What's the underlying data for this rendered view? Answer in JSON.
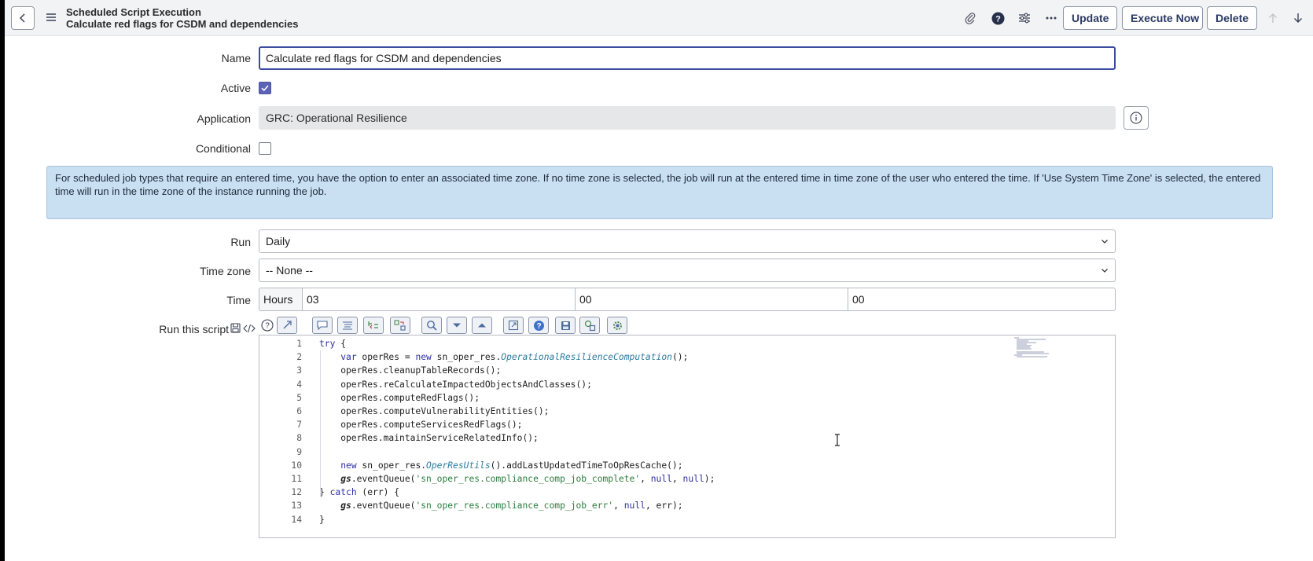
{
  "header": {
    "record_type": "Scheduled Script Execution",
    "record_name": "Calculate red flags for CSDM and dependencies",
    "buttons": {
      "update": "Update",
      "execute_now": "Execute Now",
      "delete": "Delete"
    },
    "icons": [
      "back-icon",
      "menu-icon",
      "paperclip-icon",
      "help-icon",
      "settings-sliders-icon",
      "more-icon",
      "arrow-up-icon",
      "arrow-down-icon"
    ]
  },
  "form": {
    "name": {
      "label": "Name",
      "value": "Calculate red flags for CSDM and dependencies"
    },
    "active": {
      "label": "Active",
      "checked": true
    },
    "application": {
      "label": "Application",
      "value": "GRC: Operational Resilience"
    },
    "conditional": {
      "label": "Conditional",
      "checked": false
    },
    "notice": "For scheduled job types that require an entered time, you have the option to enter an associated time zone. If no time zone is selected, the job will run at the entered time in time zone of the user who entered the time. If 'Use System Time Zone' is selected, the entered time will run in the time zone of the instance running the job.",
    "run": {
      "label": "Run",
      "value": "Daily"
    },
    "time_zone": {
      "label": "Time zone",
      "value": "-- None --"
    },
    "time": {
      "label": "Time",
      "unit": "Hours",
      "hours": "03",
      "minutes": "00",
      "seconds": "00"
    },
    "script": {
      "label": "Run this script"
    }
  },
  "script_lines": [
    {
      "n": "1",
      "text": "try {"
    },
    {
      "n": "2",
      "text": "    var operRes = new sn_oper_res.OperationalResilienceComputation();"
    },
    {
      "n": "3",
      "text": "    operRes.cleanupTableRecords();"
    },
    {
      "n": "4",
      "text": "    operRes.reCalculateImpactedObjectsAndClasses();"
    },
    {
      "n": "5",
      "text": "    operRes.computeRedFlags();"
    },
    {
      "n": "6",
      "text": "    operRes.computeVulnerabilityEntities();"
    },
    {
      "n": "7",
      "text": "    operRes.computeServicesRedFlags();"
    },
    {
      "n": "8",
      "text": "    operRes.maintainServiceRelatedInfo();"
    },
    {
      "n": "9",
      "text": ""
    },
    {
      "n": "10",
      "text": "    new sn_oper_res.OperResUtils().addLastUpdatedTimeToOpResCache();"
    },
    {
      "n": "11",
      "text": "    gs.eventQueue('sn_oper_res.compliance_comp_job_complete', null, null);"
    },
    {
      "n": "12",
      "text": "} catch (err) {"
    },
    {
      "n": "13",
      "text": "    gs.eventQueue('sn_oper_res.compliance_comp_job_err', null, err);"
    },
    {
      "n": "14",
      "text": "}"
    }
  ],
  "colors": {
    "accent": "#3b4ba0",
    "checkbox_checked": "#5a63b5",
    "notice_bg": "#c9dff2",
    "header_bg": "#f2f3f5"
  }
}
